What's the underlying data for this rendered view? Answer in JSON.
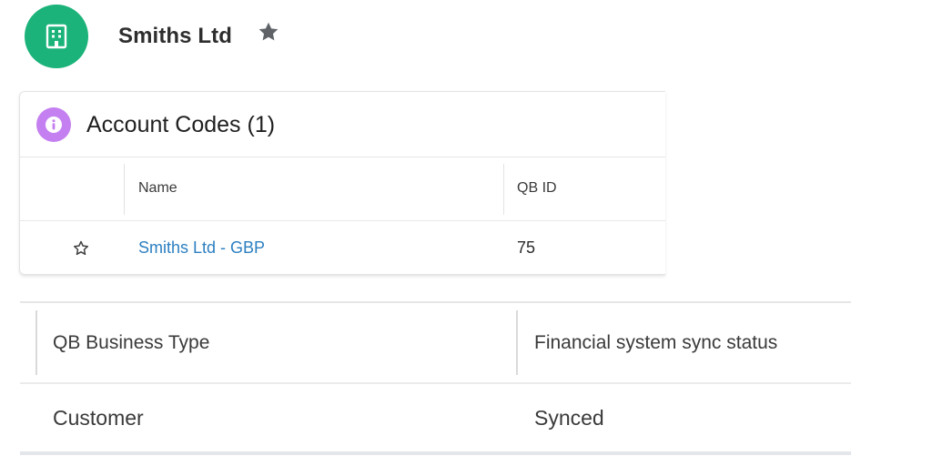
{
  "record": {
    "title": "Smiths Ltd",
    "icon": "building-icon",
    "icon_color": "#1bb37a",
    "followed": true
  },
  "related_list": {
    "title": "Account Codes (1)",
    "icon": "info-icon",
    "icon_color": "#c47ff0",
    "columns": [
      "Name",
      "QB ID"
    ],
    "rows": [
      {
        "name": "Smiths Ltd - GBP",
        "qb_id": "75",
        "starred": false
      }
    ],
    "link_color": "#2c7fc1"
  },
  "fields": {
    "columns": [
      {
        "label": "QB Business Type",
        "value": "Customer"
      },
      {
        "label": "Financial system sync status",
        "value": "Synced"
      }
    ]
  }
}
